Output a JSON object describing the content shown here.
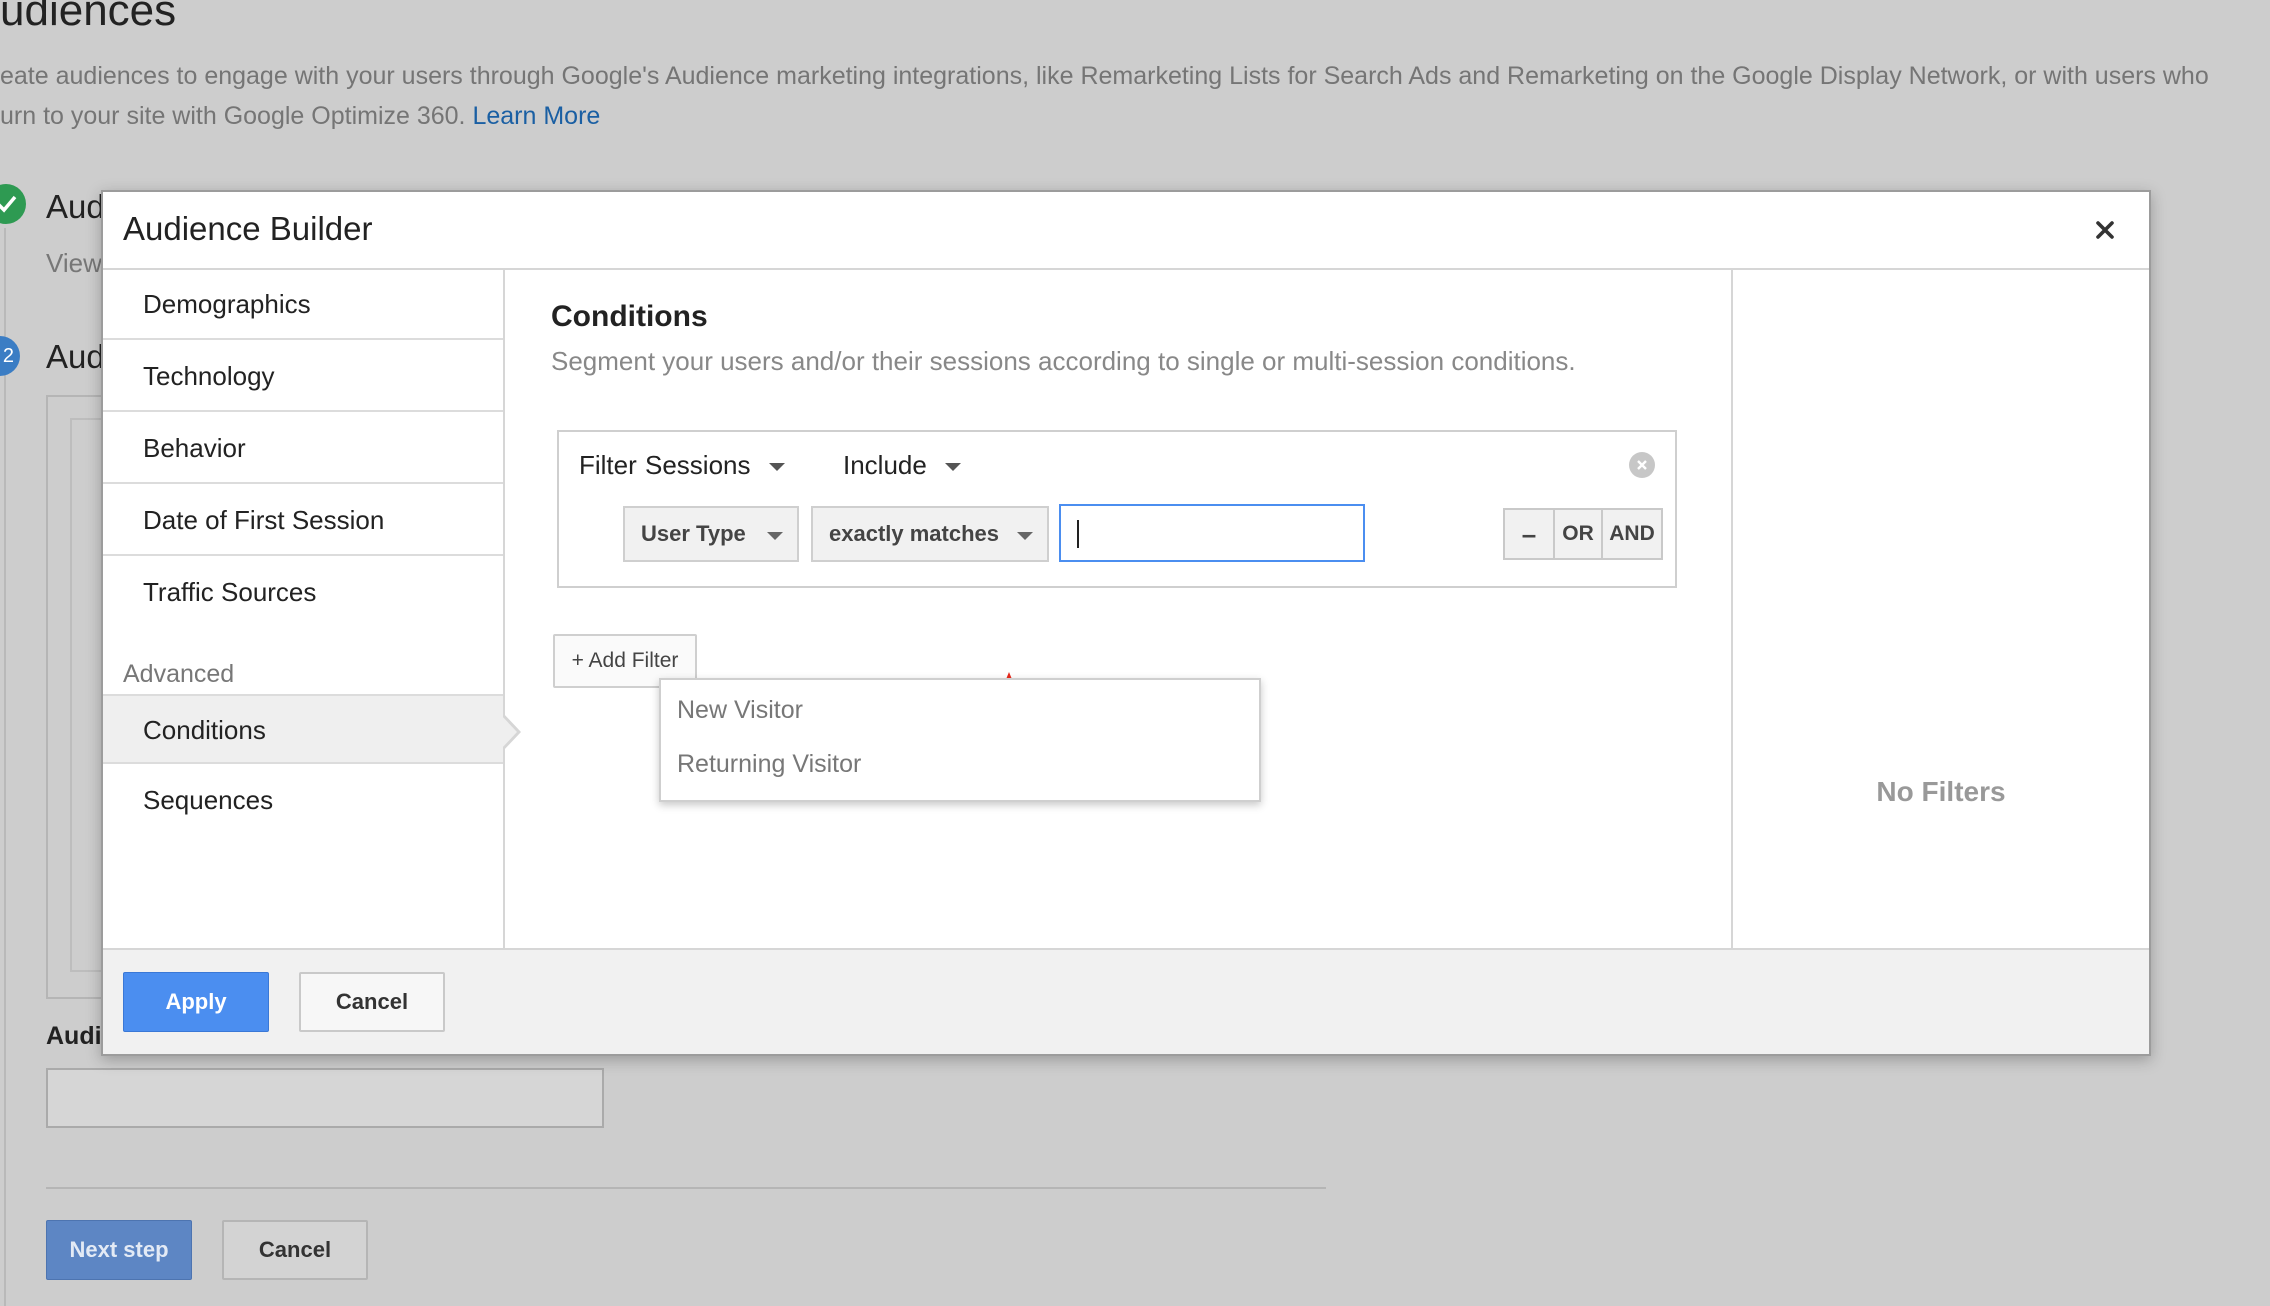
{
  "page": {
    "title": "udiences",
    "description_line1": "eate audiences to engage with your users through Google's Audience marketing integrations, like Remarketing Lists for Search Ads and Remarketing on the Google Display Network, or with users who",
    "description_line2": "urn to your site with Google Optimize 360.",
    "learn_more": "Learn More",
    "step1_heading": "Aud",
    "step1_sub": "View",
    "step2_number": "2",
    "step2_heading": "Aud",
    "audience_name_label": "Audi",
    "next_step": "Next step",
    "cancel": "Cancel"
  },
  "modal": {
    "title": "Audience Builder",
    "close_icon": "close-icon",
    "nav": {
      "items": [
        "Demographics",
        "Technology",
        "Behavior",
        "Date of First Session",
        "Traffic Sources"
      ],
      "section_label": "Advanced",
      "advanced_items": [
        "Conditions",
        "Sequences"
      ],
      "active": "Conditions"
    },
    "conditions": {
      "title": "Conditions",
      "description": "Segment your users and/or their sessions according to single or multi-session conditions.",
      "filter_label": "Filter",
      "scope": "Sessions",
      "mode": "Include",
      "dimension": "User Type",
      "operator": "exactly matches",
      "value": "",
      "remove_button": "–",
      "or_button": "OR",
      "and_button": "AND",
      "suggestions": [
        "New Visitor",
        "Returning Visitor"
      ],
      "add_filter": "+ Add Filter"
    },
    "summary": {
      "empty_text": "No Filters"
    },
    "footer": {
      "apply": "Apply",
      "cancel": "Cancel"
    },
    "colors": {
      "primary_button": "#4b8ef0",
      "annotation_arrow": "#e8291c"
    }
  }
}
